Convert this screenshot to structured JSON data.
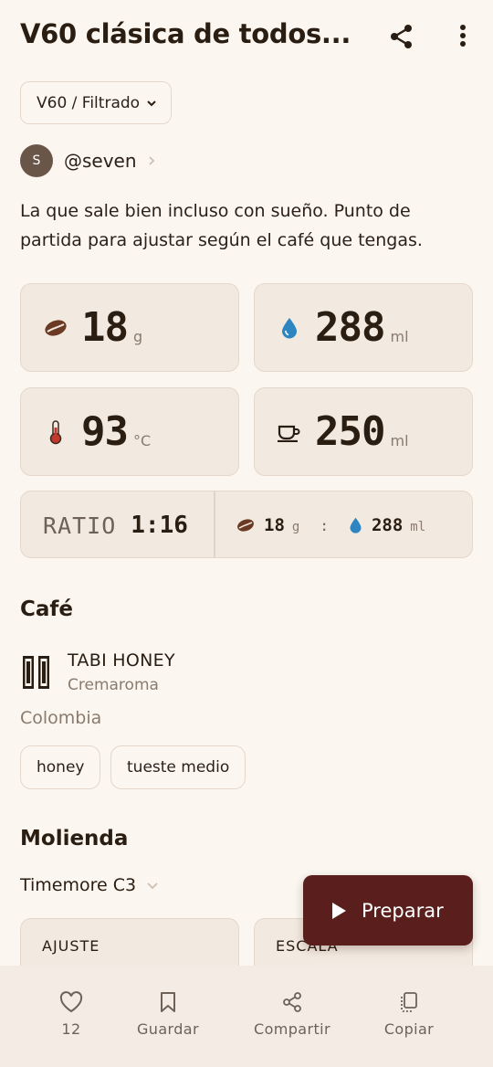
{
  "header": {
    "title": "V60 clásica de todos...",
    "share_icon": "share-icon",
    "more_icon": "more-vertical-icon"
  },
  "method": {
    "label": "V60 / Filtrado"
  },
  "author": {
    "initial": "S",
    "handle": "@seven"
  },
  "description": "La que sale bien incluso con sueño. Punto de partida para ajustar según el café que tengas.",
  "stats": {
    "coffee": {
      "value": "18",
      "unit": "g",
      "icon": "coffee-bean-icon"
    },
    "water": {
      "value": "288",
      "unit": "ml",
      "icon": "water-drop-icon"
    },
    "temp": {
      "value": "93",
      "unit": "°C",
      "icon": "thermometer-icon"
    },
    "yield": {
      "value": "250",
      "unit": "ml",
      "icon": "coffee-cup-icon"
    }
  },
  "ratio": {
    "label": "RATIO",
    "value": "1:16",
    "coffee_value": "18",
    "coffee_unit": "g",
    "separator": ":",
    "water_value": "288",
    "water_unit": "ml"
  },
  "cafe": {
    "section_title": "Café",
    "name": "TABI HONEY",
    "roaster": "Cremaroma",
    "origin": "Colombia",
    "tags": [
      "honey",
      "tueste medio"
    ]
  },
  "molienda": {
    "section_title": "Molienda",
    "grinder": "Timemore C3",
    "setting_label": "AJUSTE",
    "scale_label": "ESCALA"
  },
  "fab": {
    "label": "Preparar"
  },
  "bottom_nav": {
    "likes": "12",
    "save": "Guardar",
    "share": "Compartir",
    "copy": "Copiar"
  },
  "colors": {
    "background": "#fbf6f0",
    "card": "#f2e9e0",
    "accent": "#5a1e1c",
    "water": "#2e86c1",
    "bean": "#6b3a24"
  }
}
